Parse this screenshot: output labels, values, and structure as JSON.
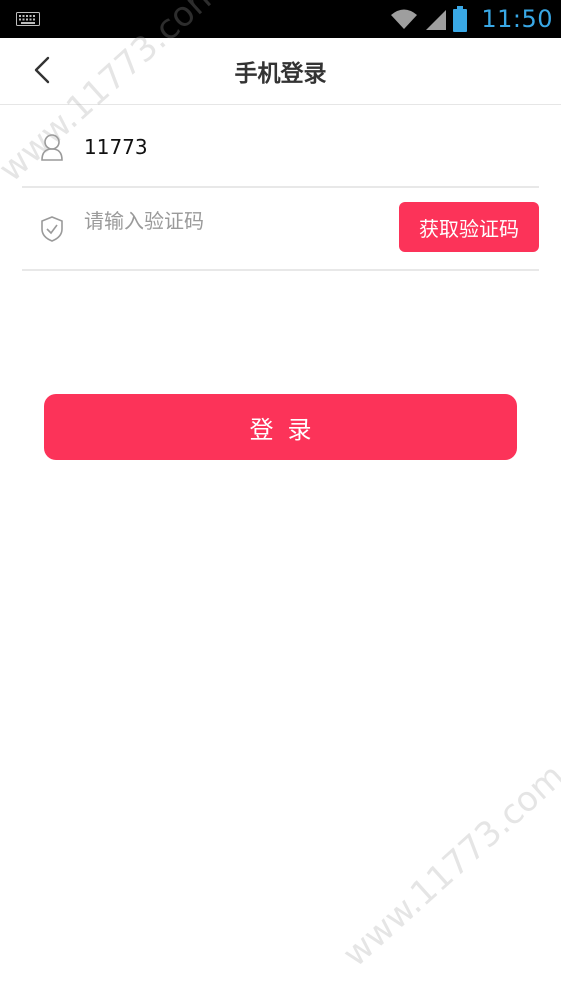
{
  "status_bar": {
    "time": "11:50",
    "icons": [
      "keyboard-icon",
      "wifi-icon",
      "signal-icon",
      "battery-icon"
    ],
    "time_color": "#39a8e6"
  },
  "header": {
    "title": "手机登录",
    "back_icon": "chevron-left-icon"
  },
  "form": {
    "phone": {
      "value": "11773",
      "icon": "user-icon"
    },
    "code": {
      "placeholder": "请输入验证码",
      "icon": "shield-check-icon"
    },
    "get_code_label": "获取验证码",
    "login_label": "登录"
  },
  "watermark": {
    "text": "www.11773.com"
  },
  "colors": {
    "accent": "#fc3359",
    "divider": "#e8e8e8"
  }
}
